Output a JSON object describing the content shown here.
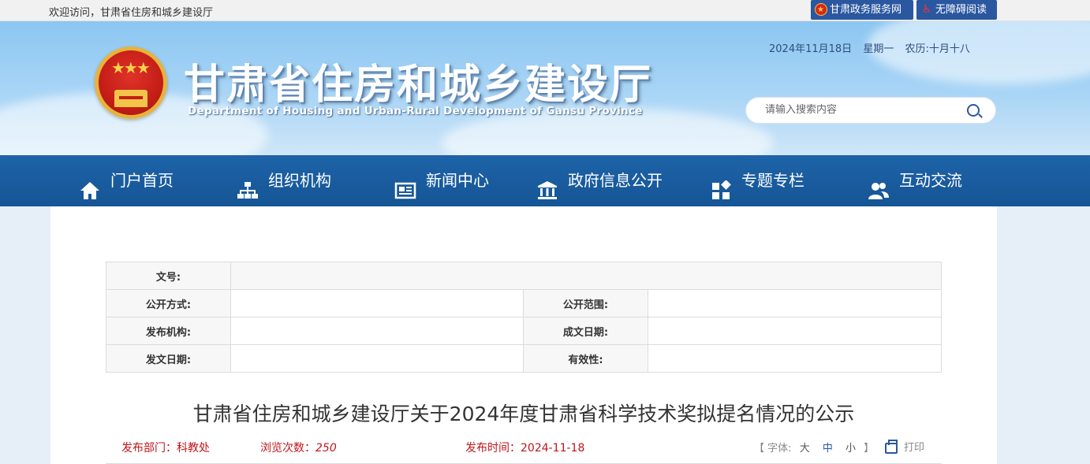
{
  "topbar": {
    "welcome": "欢迎访问，甘肃省住房和城乡建设厅",
    "gov_service_label": "甘肃政务服务网",
    "accessible_label": "无障碍阅读"
  },
  "header": {
    "title": "甘肃省住房和城乡建设厅",
    "subtitle": "Department of Housing and Urban-Rural Development of Gansu Province",
    "date": "2024年11月18日",
    "weekday": "星期一",
    "lunar": "农历:十月十八",
    "search_placeholder": "请输入搜索内容"
  },
  "nav": {
    "items": [
      {
        "label": "门户首页",
        "icon": "home-icon"
      },
      {
        "label": "组织机构",
        "icon": "org-chart-icon"
      },
      {
        "label": "新闻中心",
        "icon": "newspaper-icon"
      },
      {
        "label": "政府信息公开",
        "icon": "government-building-icon"
      },
      {
        "label": "专题专栏",
        "icon": "grid-icon"
      },
      {
        "label": "互动交流",
        "icon": "users-icon"
      }
    ]
  },
  "meta": {
    "doc_no_label": "文号:",
    "public_way_label": "公开方式:",
    "public_scope_label": "公开范围:",
    "publisher_label": "发布机构:",
    "written_date_label": "成文日期:",
    "issue_date_label": "发文日期:",
    "validity_label": "有效性:"
  },
  "article": {
    "title": "甘肃省住房和城乡建设厅关于2024年度甘肃省科学技术奖拟提名情况的公示",
    "dept_label": "发布部门：",
    "dept": "科教处",
    "views_label": "浏览次数：",
    "views": "250",
    "time_label": "发布时间：",
    "time": "2024-11-18",
    "font_open": "【",
    "font_label": "字体:",
    "font_large": "大",
    "font_medium": "中",
    "font_small": "小",
    "font_close": "】",
    "print_label": "打印"
  },
  "colors": {
    "nav_bg": "#155595",
    "accent_red": "#c0151c",
    "header_sky": "#8cc6f1"
  }
}
